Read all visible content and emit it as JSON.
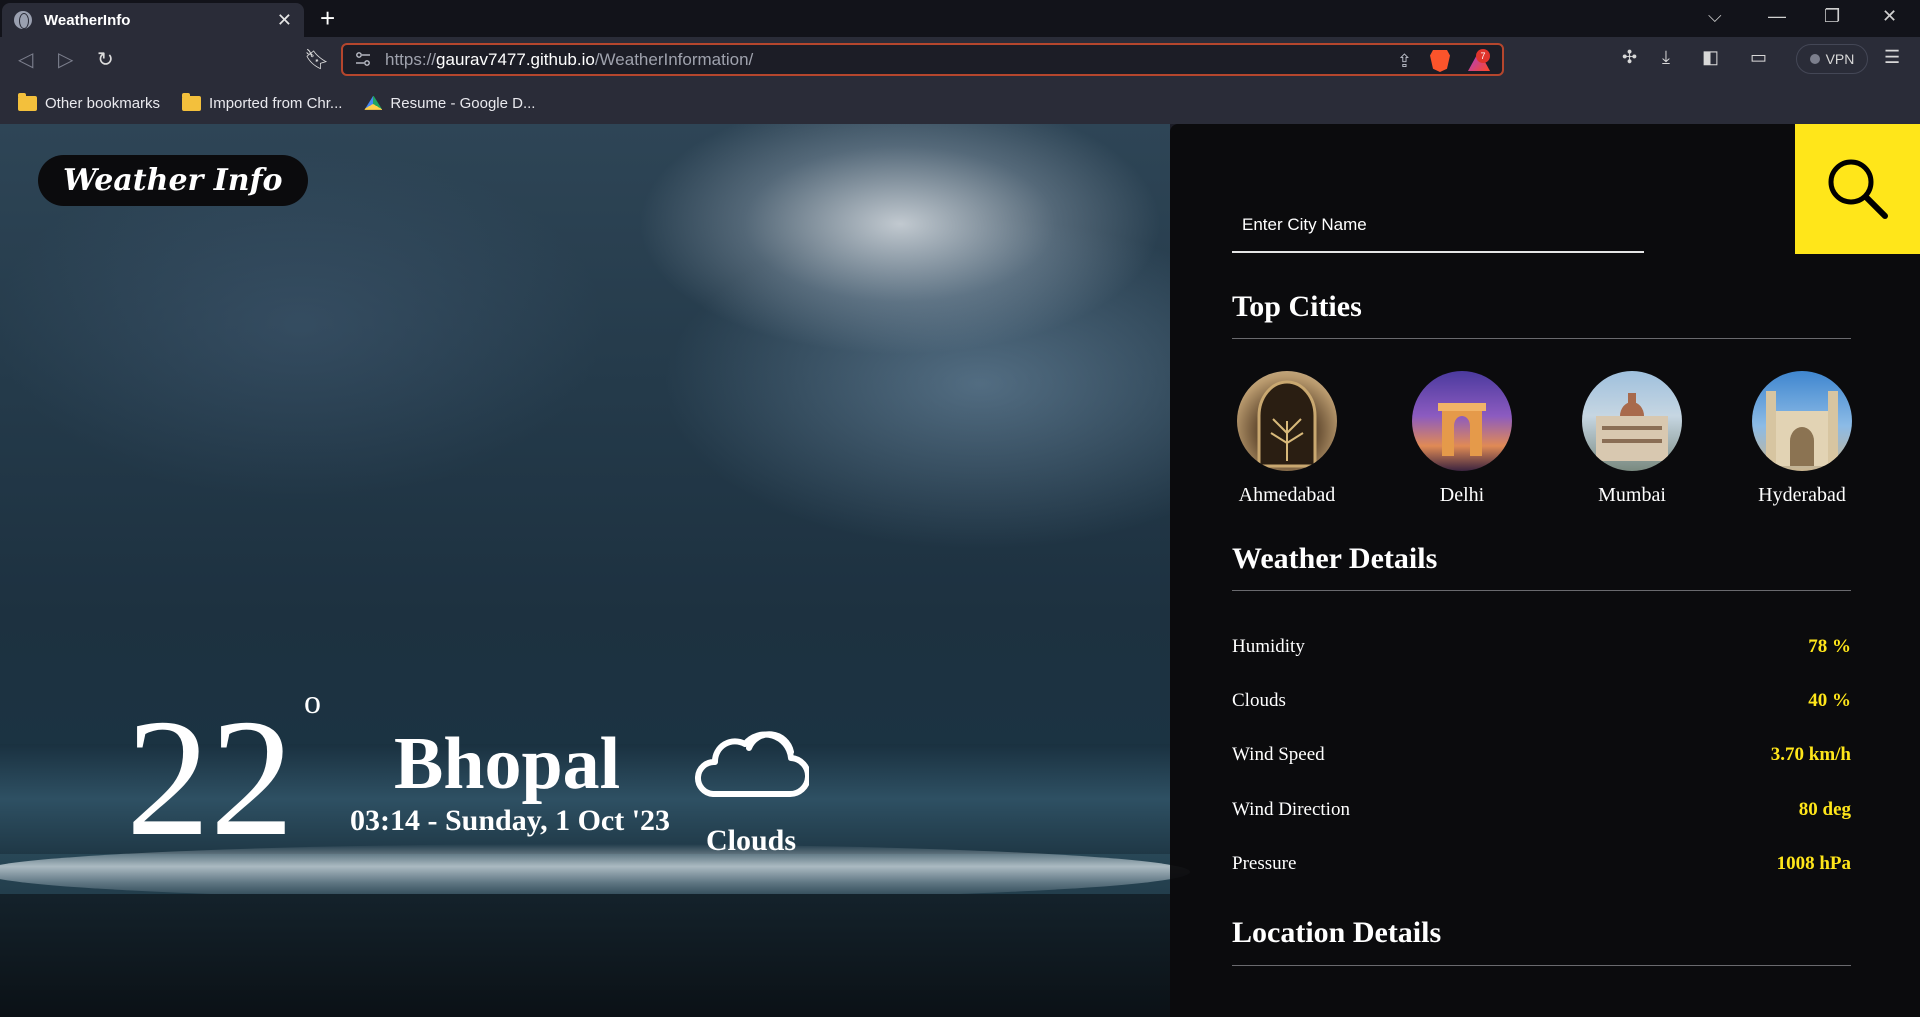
{
  "browser": {
    "tab_title": "WeatherInfo",
    "url_prefix": "https://",
    "url_host": "gaurav7477.github.io",
    "url_path": "/WeatherInformation/",
    "shield_badge": "7",
    "vpn_label": "VPN",
    "bookmarks": [
      {
        "label": "Other bookmarks",
        "icon": "folder-icon"
      },
      {
        "label": "Imported from Chr...",
        "icon": "folder-icon"
      },
      {
        "label": "Resume - Google D...",
        "icon": "google-drive-icon"
      }
    ]
  },
  "app": {
    "brand": "Weather Info",
    "temperature": "22",
    "degree_symbol": "o",
    "city": "Bhopal",
    "datetime": "03:14 - Sunday, 1 Oct '23",
    "condition": "Clouds",
    "condition_icon": "cloud-icon"
  },
  "panel": {
    "search_placeholder": "Enter City Name",
    "top_cities_title": "Top Cities",
    "top_cities": [
      {
        "name": "Ahmedabad"
      },
      {
        "name": "Delhi"
      },
      {
        "name": "Mumbai"
      },
      {
        "name": "Hyderabad"
      }
    ],
    "weather_details_title": "Weather Details",
    "weather_details": [
      {
        "label": "Humidity",
        "value": "78 %"
      },
      {
        "label": "Clouds",
        "value": "40 %"
      },
      {
        "label": "Wind Speed",
        "value": "3.70 km/h"
      },
      {
        "label": "Wind Direction",
        "value": "80 deg"
      },
      {
        "label": "Pressure",
        "value": "1008 hPa"
      }
    ],
    "location_details_title": "Location Details",
    "accent_color": "#ffe61a"
  }
}
